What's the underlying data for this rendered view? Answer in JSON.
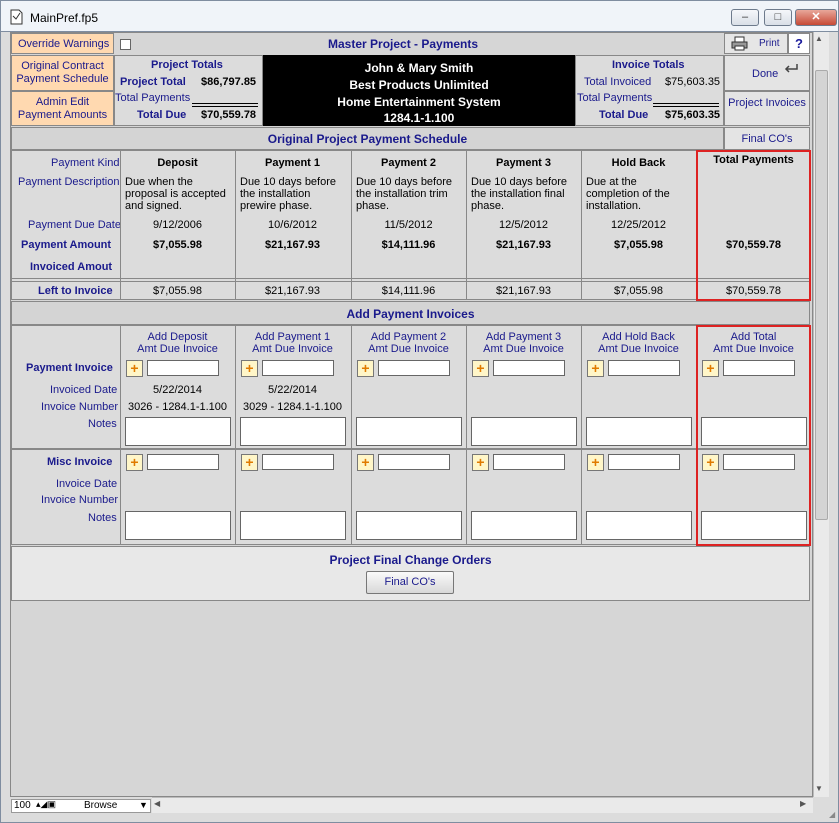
{
  "window": {
    "title": "MainPref.fp5",
    "minimize": "–",
    "restore": "□",
    "close": "✕"
  },
  "header": {
    "override_warnings": "Override Warnings",
    "master_title": "Master Project - Payments",
    "print": "Print",
    "help": "?",
    "original_contract": "Original Contract Payment Schedule",
    "admin_edit": "Admin Edit Payment Amounts",
    "project_totals": {
      "title": "Project Totals",
      "project_total_label": "Project Total",
      "project_total": "$86,797.85",
      "total_payments_label": "Total Payments",
      "total_due_label": "Total Due",
      "total_due": "$70,559.78"
    },
    "client": {
      "name": "John & Mary Smith",
      "company": "Best Products Unlimited",
      "system": "Home Entertainment System",
      "project_id": "1284.1-1.100"
    },
    "invoice_totals": {
      "title": "Invoice Totals",
      "total_invoiced_label": "Total Invoiced",
      "total_invoiced": "$75,603.35",
      "total_payments_label": "Total Payments",
      "total_due_label": "Total Due",
      "total_due": "$75,603.35"
    },
    "done": "Done",
    "project_invoices": "Project Invoices",
    "final_cos": "Final CO's"
  },
  "schedule": {
    "section_title": "Original Project Payment Schedule",
    "row_labels": {
      "kind": "Payment Kind",
      "description": "Payment Description",
      "due_date": "Payment Due Date",
      "amount": "Payment Amount",
      "invoiced": "Invoiced Amout",
      "left": "Left to Invoice"
    },
    "columns": [
      {
        "kind": "Deposit",
        "description": "Due when the proposal is accepted and signed.",
        "due_date": "9/12/2006",
        "amount": "$7,055.98",
        "left": "$7,055.98"
      },
      {
        "kind": "Payment 1",
        "description": "Due 10 days before the installation prewire phase.",
        "due_date": "10/6/2012",
        "amount": "$21,167.93",
        "left": "$21,167.93"
      },
      {
        "kind": "Payment 2",
        "description": "Due 10 days before the installation trim phase.",
        "due_date": "11/5/2012",
        "amount": "$14,111.96",
        "left": "$14,111.96"
      },
      {
        "kind": "Payment 3",
        "description": "Due 10 days before the installation final phase.",
        "due_date": "12/5/2012",
        "amount": "$21,167.93",
        "left": "$21,167.93"
      },
      {
        "kind": "Hold Back",
        "description": "Due at the completion of the installation.",
        "due_date": "12/25/2012",
        "amount": "$7,055.98",
        "left": "$7,055.98"
      }
    ],
    "total": {
      "kind": "Total Payments",
      "amount": "$70,559.78",
      "left": "$70,559.78"
    }
  },
  "invoices": {
    "section_title": "Add Payment Invoices",
    "row_labels": {
      "payment_invoice": "Payment Invoice",
      "invoiced_date": "Invoiced Date",
      "invoice_number": "Invoice Number",
      "notes": "Notes",
      "misc_invoice": "Misc Invoice",
      "invoice_date": "Invoice Date"
    },
    "columns": [
      {
        "h1": "Add Deposit",
        "h2": "Amt Due Invoice",
        "date": "5/22/2014",
        "number": "3026 - 1284.1-1.100"
      },
      {
        "h1": "Add Payment 1",
        "h2": "Amt Due Invoice",
        "date": "5/22/2014",
        "number": "3029 - 1284.1-1.100"
      },
      {
        "h1": "Add Payment 2",
        "h2": "Amt Due Invoice",
        "date": "",
        "number": ""
      },
      {
        "h1": "Add Payment 3",
        "h2": "Amt Due Invoice",
        "date": "",
        "number": ""
      },
      {
        "h1": "Add Hold Back",
        "h2": "Amt Due Invoice",
        "date": "",
        "number": ""
      },
      {
        "h1": "Add Total",
        "h2": "Amt Due Invoice",
        "date": "",
        "number": ""
      }
    ],
    "plus": "+"
  },
  "change_orders": {
    "title": "Project Final Change Orders",
    "button": "Final CO's"
  },
  "statusbar": {
    "zoom": "100",
    "mode": "Browse"
  },
  "colors": {
    "orange": "#ffd9b0",
    "black_panel": "#000000",
    "red_border": "#dd2222"
  }
}
